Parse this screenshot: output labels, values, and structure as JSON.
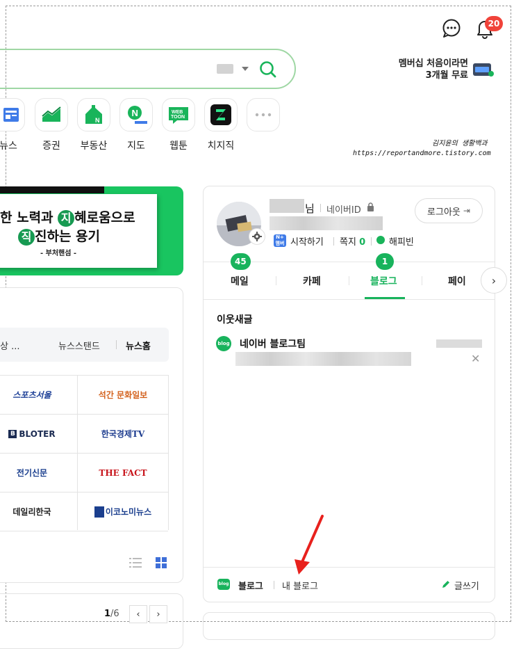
{
  "header": {
    "notification_count": "20",
    "membership_line1": "멤버십 처음이라면",
    "membership_line2": "3개월 무료"
  },
  "shortcuts": [
    {
      "label": "뉴스",
      "icon": "news-icon"
    },
    {
      "label": "증권",
      "icon": "stock-icon"
    },
    {
      "label": "부동산",
      "icon": "real-estate-icon"
    },
    {
      "label": "지도",
      "icon": "map-icon"
    },
    {
      "label": "웹툰",
      "icon": "webtoon-icon"
    },
    {
      "label": "치지직",
      "icon": "chzzk-icon"
    },
    {
      "label": "",
      "icon": "more-icon"
    }
  ],
  "watermark": {
    "line1": "김지윤의 생활백과",
    "line2": "https://reportandmore.tistory.com"
  },
  "banner": {
    "line1_pre": "한 노력과 ",
    "line1_circle": "지",
    "line1_post": "혜로움으로",
    "line2_circle": "직",
    "line2_post": "진하는 용기",
    "source": "- 부처핸섬 -"
  },
  "news": {
    "headline_tail": "상 ...",
    "newsstand": "뉴스스탠드",
    "news_home": "뉴스홈",
    "press": [
      [
        "스포츠서울",
        "석간 문화일보"
      ],
      [
        "BLOTER",
        "한국경제TV"
      ],
      [
        "전기신문",
        "THE FACT"
      ],
      [
        "데일리한국",
        "이코노미뉴스"
      ]
    ],
    "page_current": "1",
    "page_total": "/6"
  },
  "user": {
    "name_suffix": "님",
    "id_label": "네이버ID",
    "logout_label": "로그아웃",
    "pay_icon_text": "N+ 멤버십",
    "start_label": "시작하기",
    "message_label": "쪽지",
    "message_count": "0",
    "happybean_label": "해피빈",
    "tabs": [
      {
        "label": "메일",
        "count": "45"
      },
      {
        "label": "카페",
        "count": ""
      },
      {
        "label": "블로그",
        "count": "1"
      },
      {
        "label": "페이",
        "count": ""
      }
    ],
    "section_title": "이웃새글",
    "blog_badge": "blog",
    "post_author": "네이버 블로그팀",
    "bottom_blog": "블로그",
    "bottom_my_blog": "내 블로그",
    "bottom_write": "글쓰기"
  },
  "colors": {
    "naver_green": "#18b35c",
    "badge_red": "#f0433a",
    "annotation_red": "#e8211d"
  }
}
